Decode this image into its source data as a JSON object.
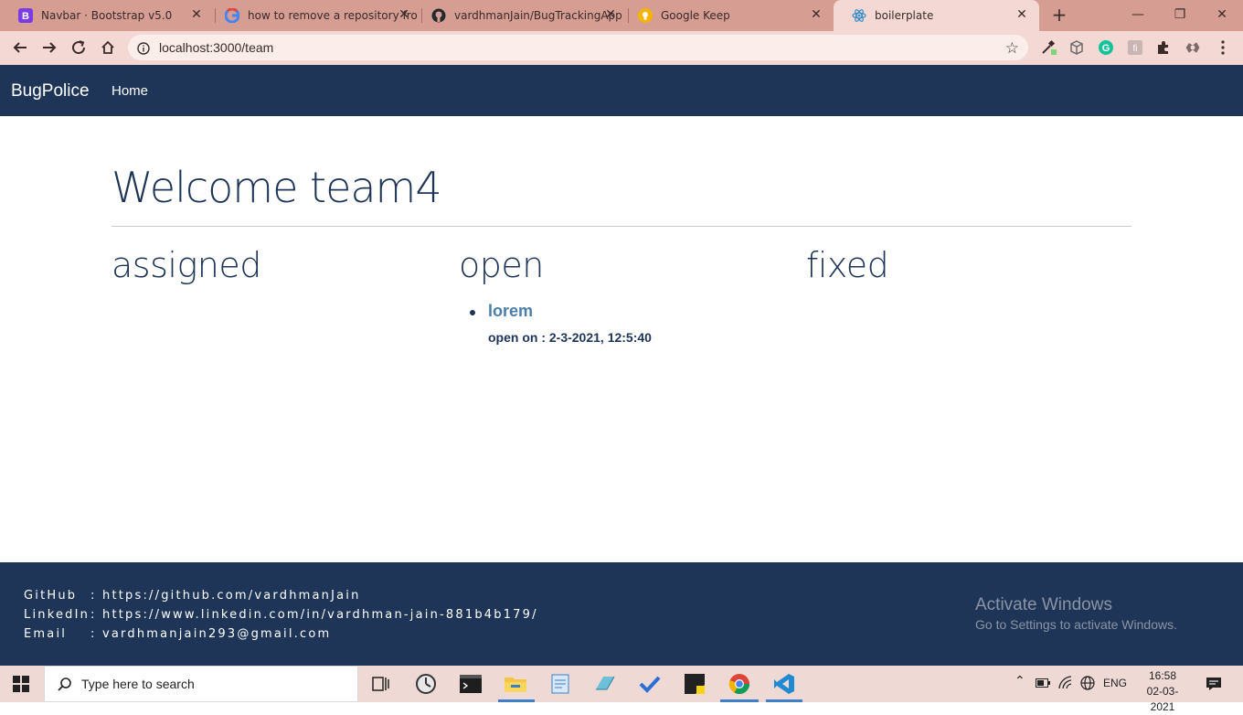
{
  "browser": {
    "tabs": [
      {
        "title": "Navbar · Bootstrap v5.0",
        "icon": "bootstrap-icon",
        "icon_color": "#7c3ae6"
      },
      {
        "title": "how to remove a repository fro",
        "icon": "google-icon"
      },
      {
        "title": "vardhmanJain/BugTrackingApp",
        "icon": "github-icon"
      },
      {
        "title": "Google Keep",
        "icon": "keep-icon",
        "icon_color": "#f4b400"
      },
      {
        "title": "boilerplate",
        "icon": "react-icon",
        "icon_color": "#3a8fc8",
        "active": true
      }
    ],
    "close_glyph": "✕",
    "address": "localhost:3000/team"
  },
  "app": {
    "brand": "BugPolice",
    "nav_home": "Home",
    "welcome": "Welcome team4",
    "columns": {
      "assigned": "assigned",
      "open": "open",
      "fixed": "fixed"
    },
    "open_bugs": [
      {
        "title": "lorem",
        "meta": "open on : 2-3-2021, 12:5:40"
      }
    ]
  },
  "footer": {
    "github_label": "GitHub",
    "github_value": "https://github.com/vardhmanJain",
    "linkedin_label": "LinkedIn",
    "linkedin_value": "https://www.linkedin.com/in/vardhman-jain-881b4b179/",
    "email_label": "Email",
    "email_value": "vardhmanjain293@gmail.com",
    "sep": ":"
  },
  "watermark": {
    "line1": "Activate Windows",
    "line2": "Go to Settings to activate Windows."
  },
  "taskbar": {
    "search_placeholder": "Type here to search",
    "lang": "ENG",
    "time": "16:58",
    "date": "02-03-2021"
  },
  "colors": {
    "navy": "#1e3557",
    "tabstrip": "#d69d93",
    "toolbar": "#f4d8d3",
    "link": "#4a7ea8"
  }
}
